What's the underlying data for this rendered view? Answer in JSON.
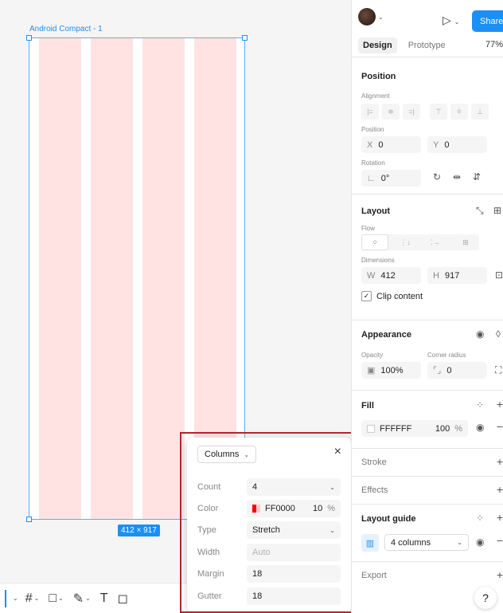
{
  "canvas": {
    "frame_label": "Android Compact - 1",
    "size_badge": "412 × 917"
  },
  "toolbar": {
    "items": [
      "frame-icon",
      "rectangle-icon",
      "pen-icon",
      "text-icon",
      "shape-icon"
    ],
    "text_glyph": "T"
  },
  "popup": {
    "type_label": "Columns",
    "close": "×",
    "rows": {
      "count": {
        "label": "Count",
        "value": "4"
      },
      "color": {
        "label": "Color",
        "hex": "FF0000",
        "opacity": "10",
        "unit": "%"
      },
      "type": {
        "label": "Type",
        "value": "Stretch"
      },
      "width": {
        "label": "Width",
        "value": "Auto"
      },
      "margin": {
        "label": "Margin",
        "value": "18"
      },
      "gutter": {
        "label": "Gutter",
        "value": "18"
      }
    }
  },
  "panel": {
    "share_label": "Share",
    "tabs": {
      "design": "Design",
      "prototype": "Prototype"
    },
    "zoom": "77%",
    "position": {
      "title": "Position",
      "alignment_label": "Alignment",
      "position_label": "Position",
      "x_key": "X",
      "x_value": "0",
      "y_key": "Y",
      "y_value": "0",
      "rotation_label": "Rotation",
      "rotation_value": "0°"
    },
    "layout": {
      "title": "Layout",
      "flow_label": "Flow",
      "dimensions_label": "Dimensions",
      "w_key": "W",
      "w_value": "412",
      "h_key": "H",
      "h_value": "917",
      "clip_content": "Clip content"
    },
    "appearance": {
      "title": "Appearance",
      "opacity_label": "Opacity",
      "opacity_value": "100%",
      "corner_label": "Corner radius",
      "corner_value": "0"
    },
    "fill": {
      "title": "Fill",
      "hex": "FFFFFF",
      "opacity": "100",
      "unit": "%"
    },
    "stroke": {
      "title": "Stroke"
    },
    "effects": {
      "title": "Effects"
    },
    "layout_guide": {
      "title": "Layout guide",
      "value": "4 columns"
    },
    "export": {
      "title": "Export"
    },
    "help": "?"
  },
  "colors": {
    "accent": "#1b8ff5",
    "column_fill": "#ffe3e3",
    "highlight_outline": "#b3262e"
  }
}
